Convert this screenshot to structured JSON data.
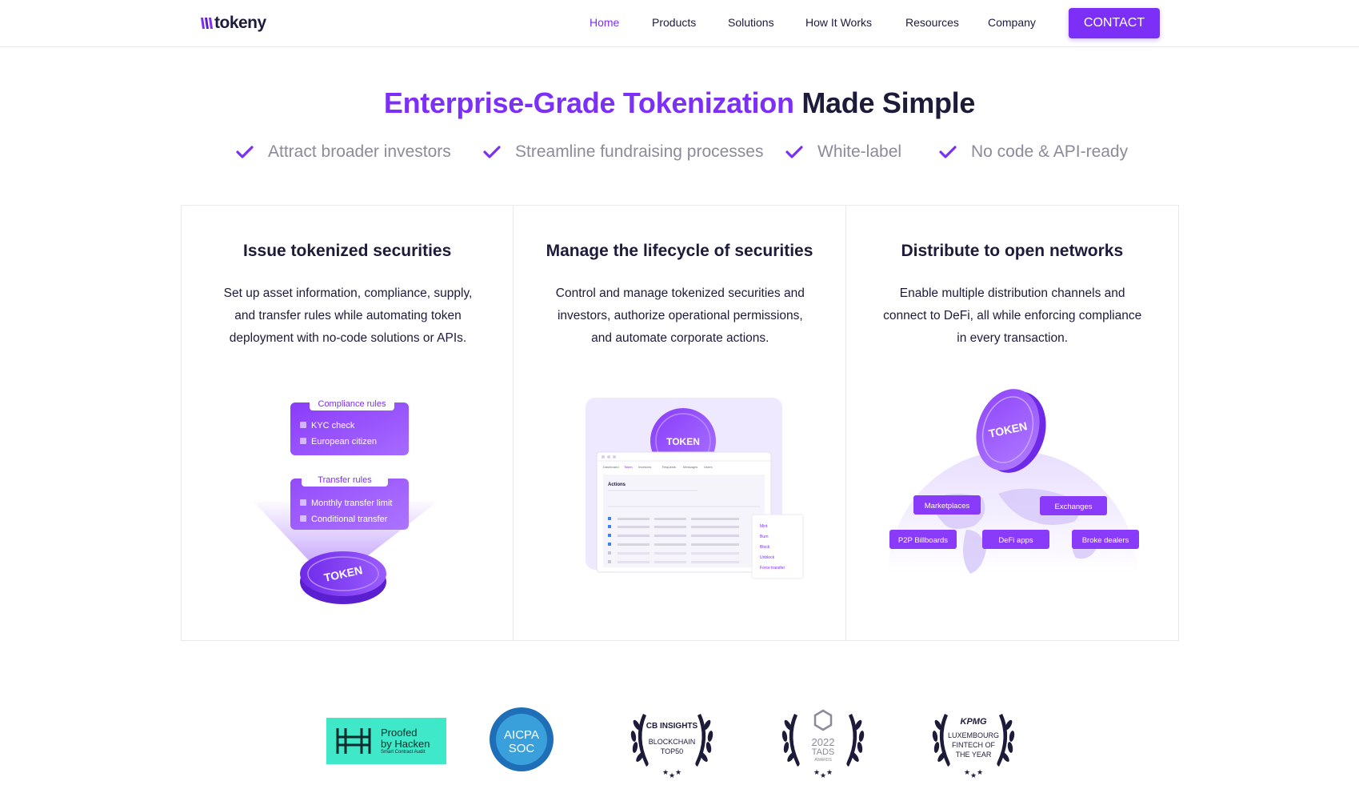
{
  "brand": {
    "name": "tokeny",
    "accent": "#7b2ff7",
    "dark": "#1c1b3a"
  },
  "nav": {
    "items": [
      {
        "label": "Home",
        "active": true
      },
      {
        "label": "Products"
      },
      {
        "label": "Solutions"
      },
      {
        "label": "How It Works"
      },
      {
        "label": "Resources"
      },
      {
        "label": "Company"
      }
    ],
    "cta": "CONTACT"
  },
  "hero": {
    "title_accent": "Enterprise-Grade Tokenization",
    "title_rest": "Made Simple",
    "features": [
      "Attract broader investors",
      "Streamline fundraising processes",
      "White-label",
      "No code & API-ready"
    ]
  },
  "cards": [
    {
      "title": "Issue tokenized securities",
      "desc": "Set up asset information, compliance, supply, and transfer rules while automating token deployment with no-code solutions or APIs.",
      "illus": {
        "compliance_label": "Compliance rules",
        "compliance_items": [
          "KYC check",
          "European citizen"
        ],
        "transfer_label": "Transfer rules",
        "transfer_items": [
          "Monthly transfer limit",
          "Conditional transfer"
        ],
        "coin_label": "TOKEN"
      }
    },
    {
      "title": "Manage the lifecycle of securities",
      "desc": "Control and manage tokenized securities and investors, authorize operational permissions, and automate corporate actions.",
      "illus": {
        "coin_label": "TOKEN",
        "tabs": [
          "Dashboard",
          "Token",
          "Investors",
          "Requests",
          "Messages",
          "Users"
        ],
        "panel_title": "Actions",
        "actions": [
          "Mint",
          "Burn",
          "Block",
          "Unblock",
          "Force transfer"
        ]
      }
    },
    {
      "title": "Distribute to open networks",
      "desc": "Enable multiple distribution channels and connect to DeFi, all while enforcing compliance in every transaction.",
      "illus": {
        "coin_label": "TOKEN",
        "channels": [
          "Marketplaces",
          "Exchanges",
          "P2P Billboards",
          "DeFi apps",
          "Broke dealers"
        ]
      }
    }
  ],
  "badges": {
    "hacken": {
      "line1": "Proofed",
      "line2": "by Hacken",
      "sub": "Smart Contract Audit"
    },
    "aicpa": {
      "line1": "AICPA",
      "line2": "SOC"
    },
    "cb": {
      "line1": "CB INSIGHTS",
      "line2": "BLOCKCHAIN",
      "line3": "TOP50"
    },
    "tads": {
      "line1": "2022",
      "line2": "TADS",
      "line3": "AWARDS"
    },
    "kpmg": {
      "line1": "KPMG",
      "line2": "LUXEMBOURG",
      "line3": "FINTECH OF",
      "line4": "THE YEAR"
    }
  }
}
